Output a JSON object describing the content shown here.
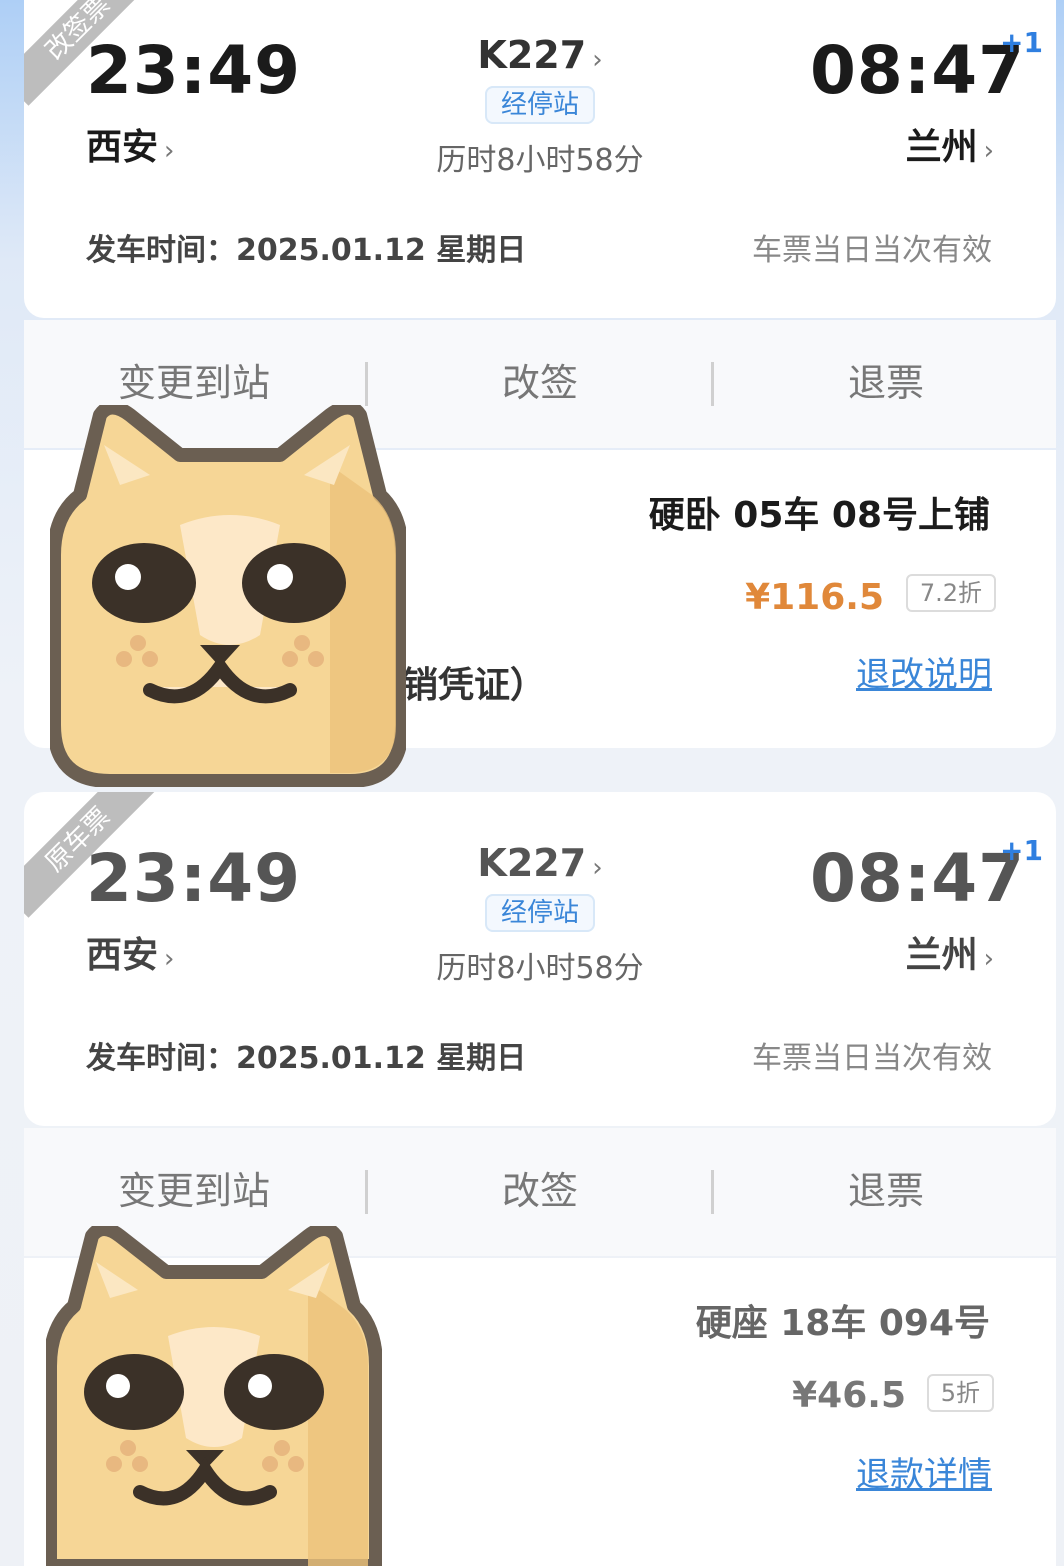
{
  "ticket_new": {
    "ribbon": "改签票",
    "depart_time": "23:49",
    "depart_station": "西安",
    "train_no": "K227",
    "stops_label": "经停站",
    "duration": "历时8小时58分",
    "arrive_time": "08:47",
    "day_offset": "+1",
    "arrive_station": "兰州",
    "depart_date": "发车时间：2025.01.12 星期日",
    "validity": "车票当日当次有效",
    "actions": [
      "变更到站",
      "改签",
      "退票"
    ],
    "seat": "硬卧 05车 08号上铺",
    "price": "¥116.5",
    "discount": "7.2折",
    "partial_text": "销凭证）",
    "link": "退改说明"
  },
  "ticket_original": {
    "ribbon": "原车票",
    "depart_time": "23:49",
    "depart_station": "西安",
    "train_no": "K227",
    "stops_label": "经停站",
    "duration": "历时8小时58分",
    "arrive_time": "08:47",
    "day_offset": "+1",
    "arrive_station": "兰州",
    "depart_date": "发车时间：2025.01.12 星期日",
    "validity": "车票当日当次有效",
    "actions": [
      "变更到站",
      "改签",
      "退票"
    ],
    "seat": "硬座 18车 094号",
    "price": "¥46.5",
    "discount": "5折",
    "link": "退款详情"
  },
  "colors": {
    "accent": "#3a86d8",
    "price_orange": "#e0883a",
    "plus_blue": "#2f7fe0"
  },
  "icons": {
    "chevron": "›",
    "mascot": "cat-mascot-icon"
  }
}
